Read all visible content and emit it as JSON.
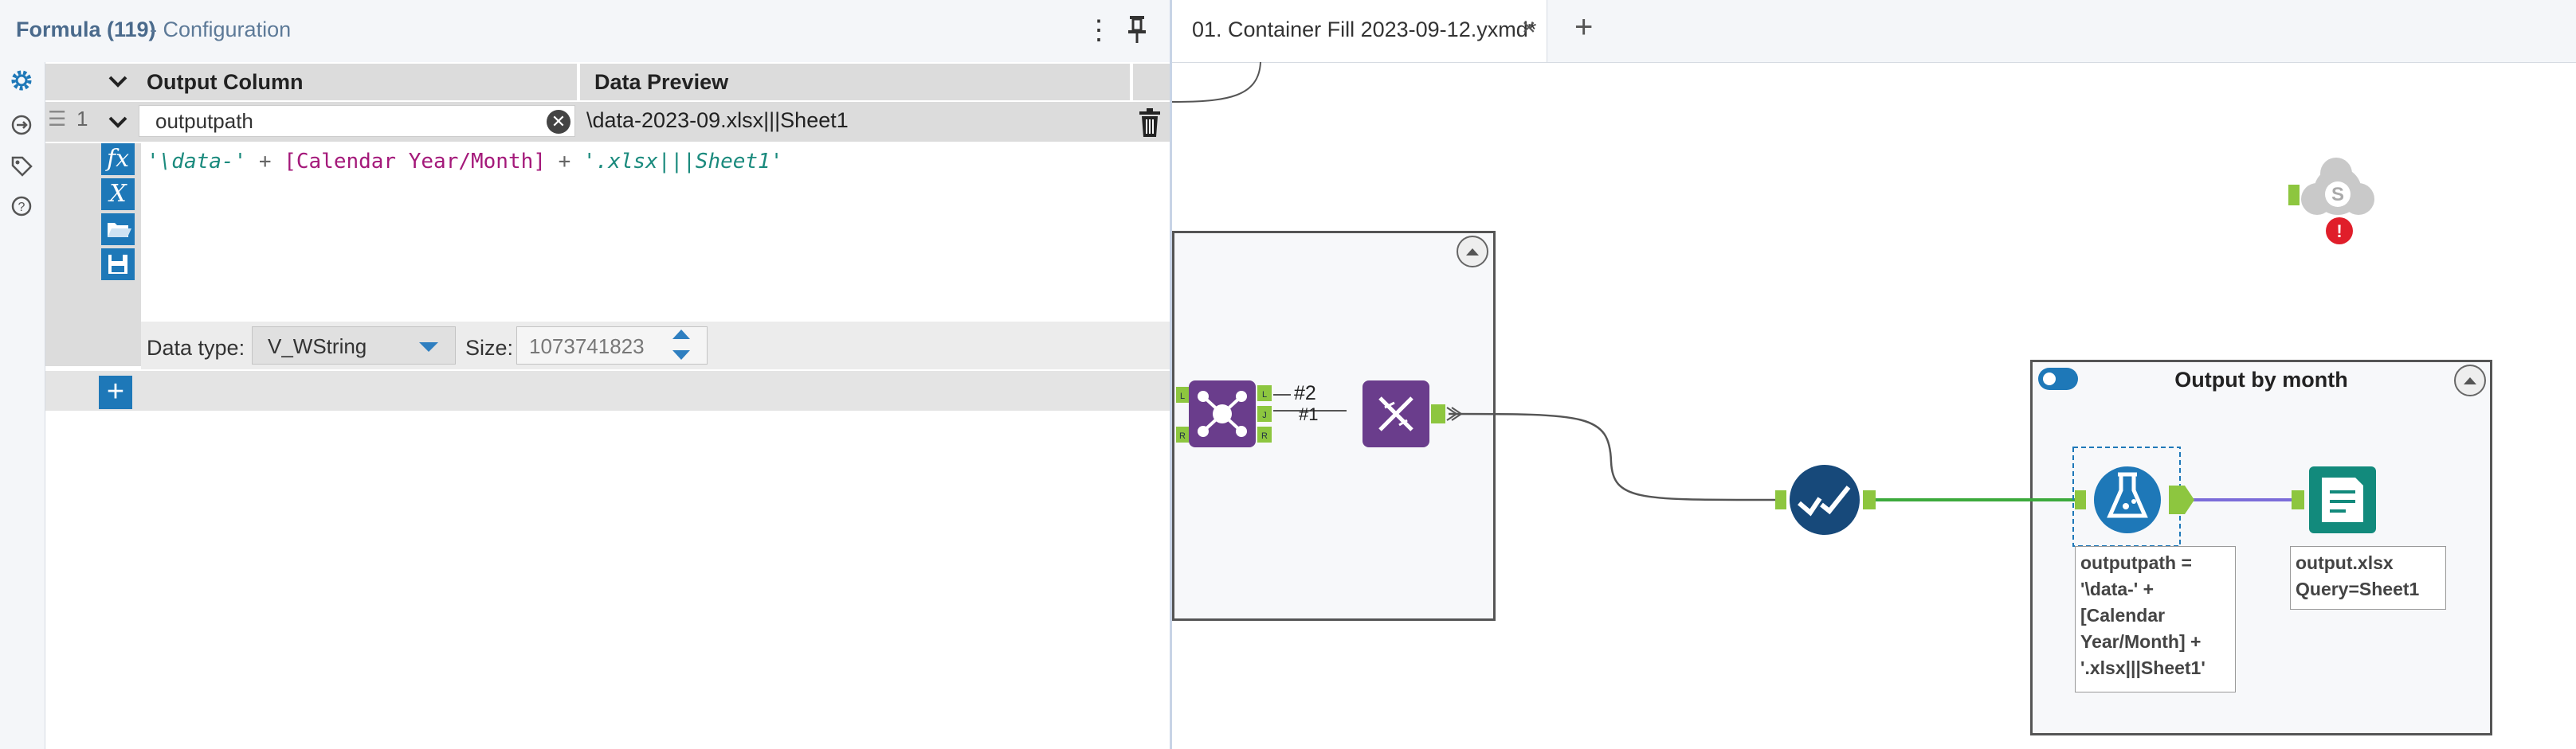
{
  "config_panel": {
    "title": "Formula (119)",
    "subtitle": "- Configuration",
    "menu_glyph": "⋮",
    "headers": {
      "output_column": "Output Column",
      "data_preview": "Data Preview"
    },
    "rows": [
      {
        "number": "1",
        "output_column": "outputpath",
        "data_preview": "\\data-2023-09.xlsx|||Sheet1",
        "expression": {
          "str1": "'\\data-'",
          "op1": " + ",
          "field": "[Calendar Year/Month]",
          "op2": " + ",
          "str2": "'.xlsx|||Sheet1'"
        },
        "data_type_label": "Data type:",
        "data_type": "V_WString",
        "size_label": "Size:",
        "size": "1073741823"
      }
    ],
    "expr_buttons": [
      "fx",
      "X",
      "open-folder",
      "save"
    ],
    "add_glyph": "+",
    "clear_glyph": "✕"
  },
  "canvas": {
    "tab": {
      "label": "01. Container Fill 2023-09-12.yxmd*",
      "close": "×"
    },
    "new_tab": "+",
    "container_output": {
      "title": "Output by month",
      "enabled": true
    },
    "join_labels": {
      "top": "#2",
      "bottom": "#1"
    },
    "formula_annotation": "outputpath =\n'\\data-' +\n[Calendar\nYear/Month] +\n'.xlsx|||Sheet1'",
    "output_annotation": "output.xlsx\nQuery=Sheet1",
    "join_anchor_letters": {
      "in_left": "L",
      "in_right": "R",
      "out_left": "L",
      "out_join": "J",
      "out_right": "R"
    },
    "colors": {
      "accent": "#1e78b8",
      "purple_tool": "#6a3d8c",
      "teal_tool": "#128a7c",
      "anchor": "#8dc63f",
      "wire_green": "#3caa3c",
      "wire_purple": "#7b6cd9",
      "error": "#e01e2a"
    }
  }
}
